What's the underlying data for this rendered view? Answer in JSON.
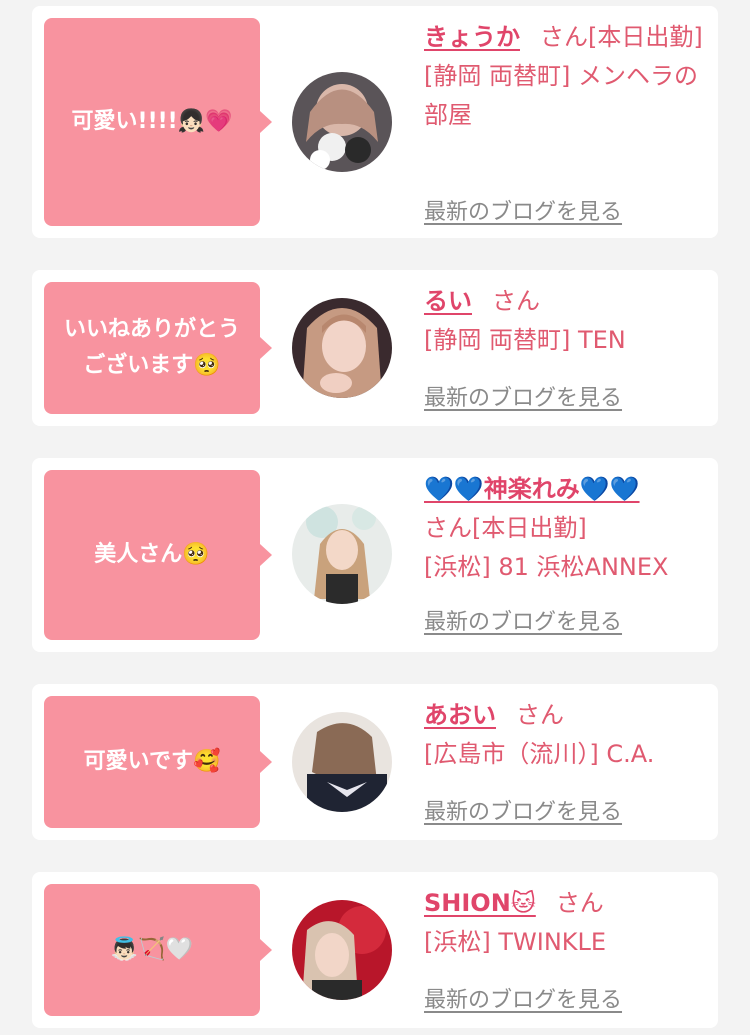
{
  "colors": {
    "bubble": "#f8939f",
    "name": "#e0456a",
    "text": "#e05a70",
    "link": "#8a8a8a",
    "background": "#f3f3f3"
  },
  "entries": [
    {
      "comment": "可愛い!!!!👧🏻💗",
      "name": "きょうか",
      "suffix": "さん[本日出勤]",
      "shop": "[静岡 両替町] メンヘラの部屋",
      "blog": "最新のブログを見る"
    },
    {
      "comment": "いいねありがとうございます🥺",
      "name": "るい",
      "suffix": "さん",
      "shop": "[静岡 両替町] TEN",
      "blog": "最新のブログを見る"
    },
    {
      "comment": "美人さん🥺",
      "name": "💙💙神楽れみ💙💙",
      "suffix": "さん[本日出勤]",
      "shop": "[浜松] 81 浜松ANNEX",
      "blog": "最新のブログを見る"
    },
    {
      "comment": "可愛いです🥰",
      "name": "あおい",
      "suffix": "さん",
      "shop": "[広島市（流川）] C.A.",
      "blog": "最新のブログを見る"
    },
    {
      "comment": "👼🏻🏹🤍",
      "name": "SHION🐱",
      "suffix": "さん",
      "shop": "[浜松] TWINKLE",
      "blog": "最新のブログを見る"
    }
  ]
}
